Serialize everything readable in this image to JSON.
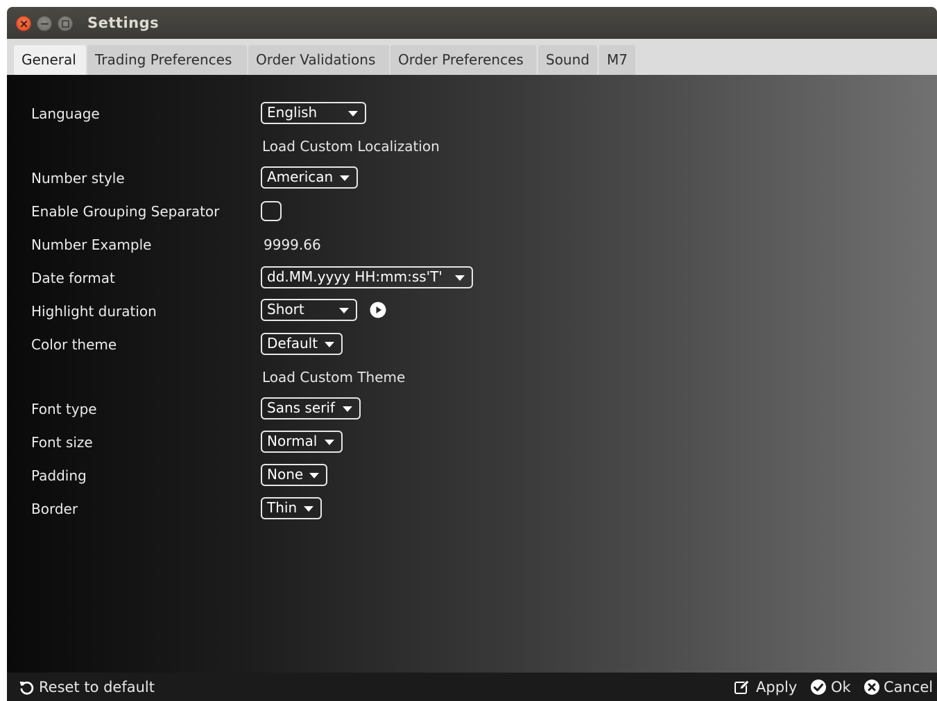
{
  "window": {
    "title": "Settings"
  },
  "tabs": [
    {
      "label": "General",
      "active": true
    },
    {
      "label": "Trading Preferences",
      "active": false
    },
    {
      "label": "Order Validations",
      "active": false
    },
    {
      "label": "Order Preferences",
      "active": false
    },
    {
      "label": "Sound",
      "active": false
    },
    {
      "label": "M7",
      "active": false
    }
  ],
  "general": {
    "language": {
      "label": "Language",
      "value": "English"
    },
    "load_custom_localization": "Load Custom Localization",
    "number_style": {
      "label": "Number style",
      "value": "American"
    },
    "grouping_separator": {
      "label": "Enable Grouping Separator",
      "checked": false
    },
    "number_example": {
      "label": "Number Example",
      "value": "9999.66"
    },
    "date_format": {
      "label": "Date format",
      "value": "dd.MM.yyyy HH:mm:ss'T'"
    },
    "highlight_duration": {
      "label": "Highlight duration",
      "value": "Short"
    },
    "color_theme": {
      "label": "Color theme",
      "value": "Default"
    },
    "load_custom_theme": "Load Custom Theme",
    "font_type": {
      "label": "Font type",
      "value": "Sans serif"
    },
    "font_size": {
      "label": "Font size",
      "value": "Normal"
    },
    "padding": {
      "label": "Padding",
      "value": "None"
    },
    "border": {
      "label": "Border",
      "value": "Thin"
    }
  },
  "footer": {
    "reset_label": "Reset to default",
    "apply_label": "Apply",
    "ok_label": "Ok",
    "cancel_label": "Cancel"
  },
  "icons": {
    "reset": "undo-icon",
    "apply": "edit-icon",
    "ok": "check-circle-icon",
    "cancel": "x-circle-icon",
    "play": "play-circle-icon"
  },
  "colors": {
    "titlebar": "#3b3a36",
    "close_button": "#e0471d",
    "tab_bar": "#dcdcdc",
    "content_dark": "#0a0a0a",
    "content_light": "#717171",
    "footer": "#1b1b1b"
  }
}
